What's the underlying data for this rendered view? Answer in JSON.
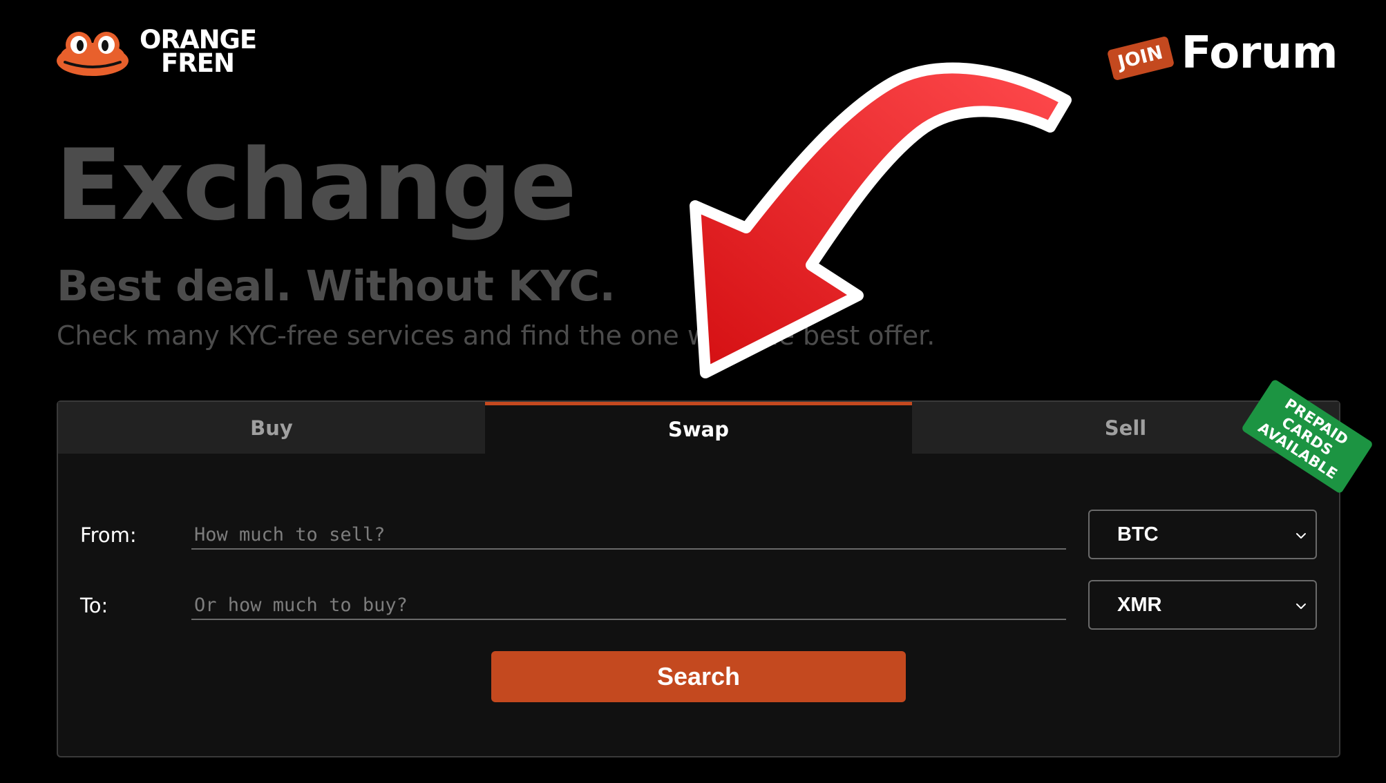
{
  "header": {
    "logo_line1": "ORANGE",
    "logo_line2": "FREN",
    "join_badge": "JOIN",
    "forum_label": "Forum"
  },
  "hero": {
    "title": "Exchange",
    "subtitle": "Best deal. Without KYC.",
    "description": "Check many KYC-free services and find the one with the best offer."
  },
  "tabs": [
    {
      "label": "Buy",
      "active": false
    },
    {
      "label": "Swap",
      "active": true
    },
    {
      "label": "Sell",
      "active": false
    }
  ],
  "ribbon": {
    "line1": "PREPAID CARDS",
    "line2": "AVAILABLE"
  },
  "form": {
    "from_label": "From:",
    "from_placeholder": "How much to sell?",
    "from_currency": "BTC",
    "to_label": "To:",
    "to_placeholder": "Or how much to buy?",
    "to_currency": "XMR",
    "search_label": "Search"
  },
  "colors": {
    "background": "#000000",
    "accent": "#c4491f",
    "card": "#111111",
    "tab_inactive": "#222222",
    "ribbon": "#1c9442",
    "muted_text": "#4c4c4c",
    "arrow": "#e8282b"
  },
  "icons": {
    "logo": "frog-logo-icon",
    "select_arrow": "chevron-down-icon",
    "overlay": "curved-arrow-icon"
  }
}
